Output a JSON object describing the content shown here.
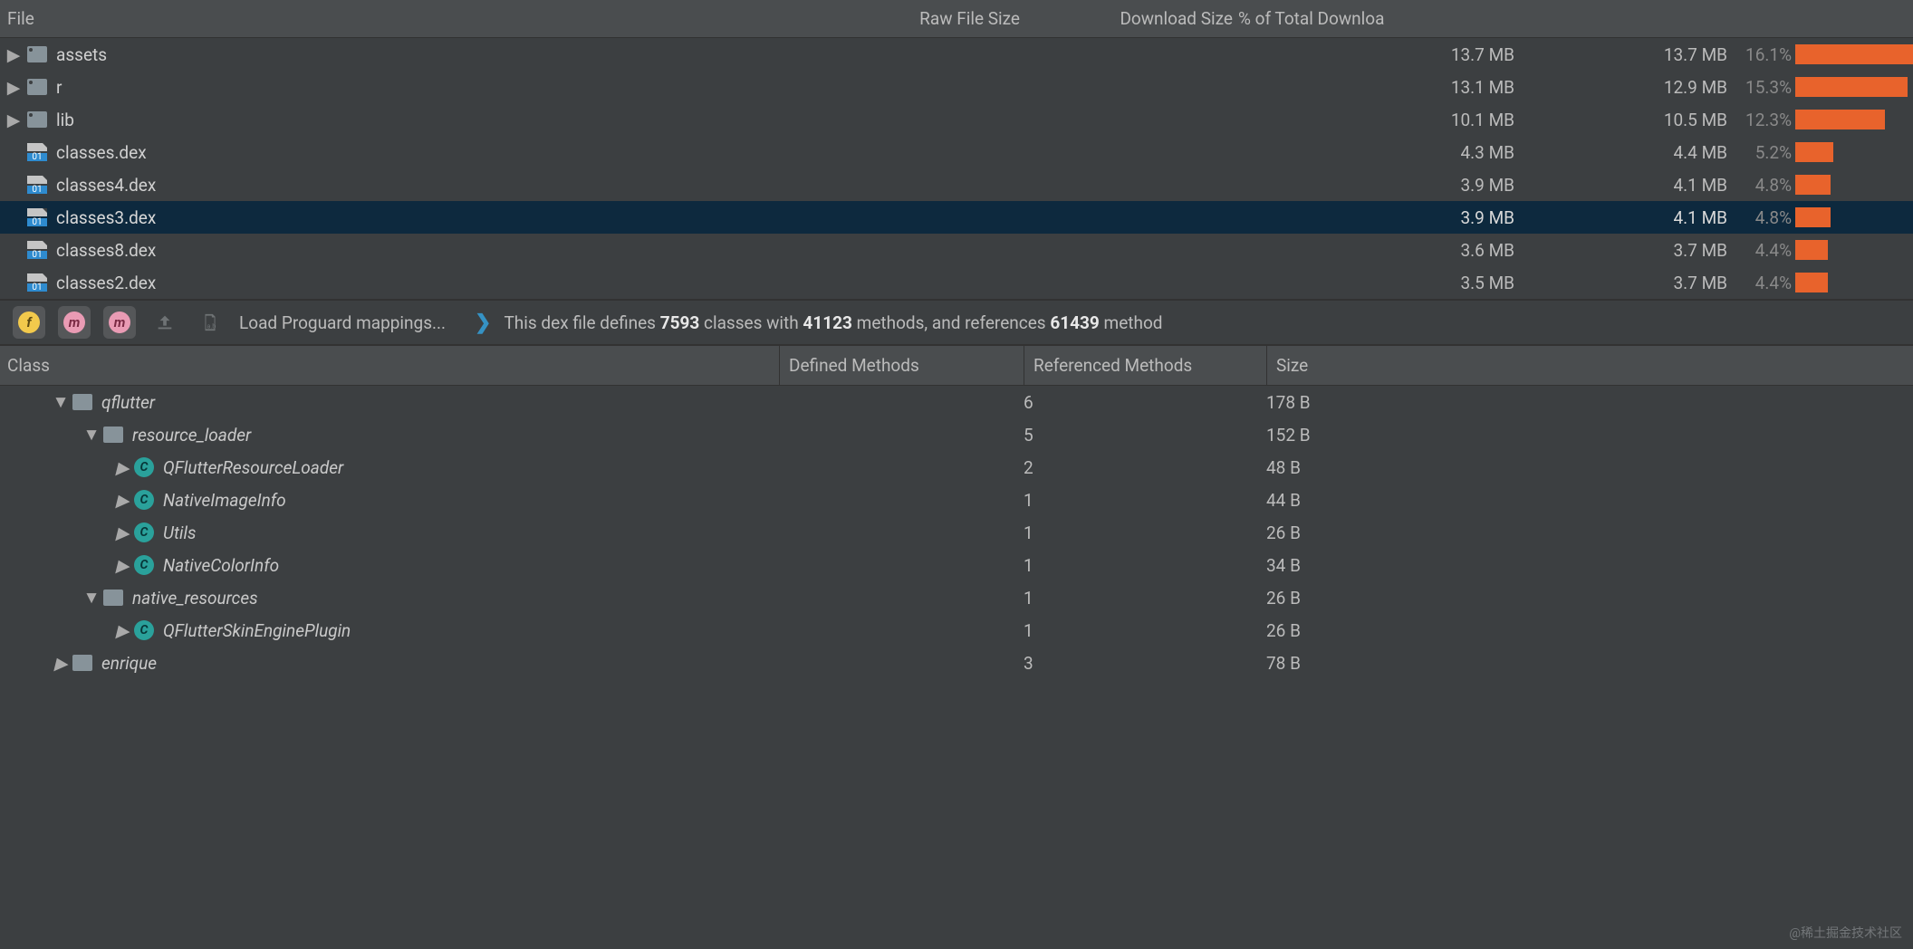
{
  "colors": {
    "accent_bar": "#e8632c",
    "selection": "#0d293e"
  },
  "top": {
    "headers": {
      "file": "File",
      "raw": "Raw File Size",
      "dl": "Download Size",
      "pct": "% of Total Downloa"
    },
    "rows": [
      {
        "name": "assets",
        "kind": "dir",
        "expandable": true,
        "raw": "13.7 MB",
        "dl": "13.7 MB",
        "pct_label": "16.1%",
        "pct": 16.1,
        "selected": false
      },
      {
        "name": "r",
        "kind": "dir",
        "expandable": true,
        "raw": "13.1 MB",
        "dl": "12.9 MB",
        "pct_label": "15.3%",
        "pct": 15.3,
        "selected": false
      },
      {
        "name": "lib",
        "kind": "dir",
        "expandable": true,
        "raw": "10.1 MB",
        "dl": "10.5 MB",
        "pct_label": "12.3%",
        "pct": 12.3,
        "selected": false
      },
      {
        "name": "classes.dex",
        "kind": "dex",
        "expandable": false,
        "raw": "4.3 MB",
        "dl": "4.4 MB",
        "pct_label": "5.2%",
        "pct": 5.2,
        "selected": false
      },
      {
        "name": "classes4.dex",
        "kind": "dex",
        "expandable": false,
        "raw": "3.9 MB",
        "dl": "4.1 MB",
        "pct_label": "4.8%",
        "pct": 4.8,
        "selected": false
      },
      {
        "name": "classes3.dex",
        "kind": "dex",
        "expandable": false,
        "raw": "3.9 MB",
        "dl": "4.1 MB",
        "pct_label": "4.8%",
        "pct": 4.8,
        "selected": true
      },
      {
        "name": "classes8.dex",
        "kind": "dex",
        "expandable": false,
        "raw": "3.6 MB",
        "dl": "3.7 MB",
        "pct_label": "4.4%",
        "pct": 4.4,
        "selected": false
      },
      {
        "name": "classes2.dex",
        "kind": "dex",
        "expandable": false,
        "raw": "3.5 MB",
        "dl": "3.7 MB",
        "pct_label": "4.4%",
        "pct": 4.4,
        "selected": false
      }
    ]
  },
  "toolbar": {
    "btn_f": "f",
    "btn_m": "m",
    "btn_mf": "m",
    "load_mappings": "Load Proguard mappings...",
    "info_prefix": "This dex file defines ",
    "classes": "7593",
    "info_mid1": " classes with ",
    "methods": "41123",
    "info_mid2": " methods, and references ",
    "refs": "61439",
    "info_suffix": " method"
  },
  "classes": {
    "headers": {
      "cls": "Class",
      "def": "Defined Methods",
      "ref": "Referenced Methods",
      "size": "Size"
    },
    "rows": [
      {
        "indent": 1,
        "arrow": "down",
        "kind": "pkg",
        "name": "qflutter",
        "def": "",
        "ref": "6",
        "size": "178 B"
      },
      {
        "indent": 2,
        "arrow": "down",
        "kind": "pkg",
        "name": "resource_loader",
        "def": "",
        "ref": "5",
        "size": "152 B"
      },
      {
        "indent": 3,
        "arrow": "right",
        "kind": "cls",
        "name": "QFlutterResourceLoader",
        "def": "",
        "ref": "2",
        "size": "48 B"
      },
      {
        "indent": 3,
        "arrow": "right",
        "kind": "cls",
        "name": "NativeImageInfo",
        "def": "",
        "ref": "1",
        "size": "44 B"
      },
      {
        "indent": 3,
        "arrow": "right",
        "kind": "cls",
        "name": "Utils",
        "def": "",
        "ref": "1",
        "size": "26 B"
      },
      {
        "indent": 3,
        "arrow": "right",
        "kind": "cls",
        "name": "NativeColorInfo",
        "def": "",
        "ref": "1",
        "size": "34 B"
      },
      {
        "indent": 2,
        "arrow": "down",
        "kind": "pkg",
        "name": "native_resources",
        "def": "",
        "ref": "1",
        "size": "26 B"
      },
      {
        "indent": 3,
        "arrow": "right",
        "kind": "cls",
        "name": "QFlutterSkinEnginePlugin",
        "def": "",
        "ref": "1",
        "size": "26 B"
      },
      {
        "indent": 1,
        "arrow": "right",
        "kind": "pkg",
        "name": "enrique",
        "def": "",
        "ref": "3",
        "size": "78 B"
      }
    ]
  },
  "watermark": "@稀土掘金技术社区"
}
